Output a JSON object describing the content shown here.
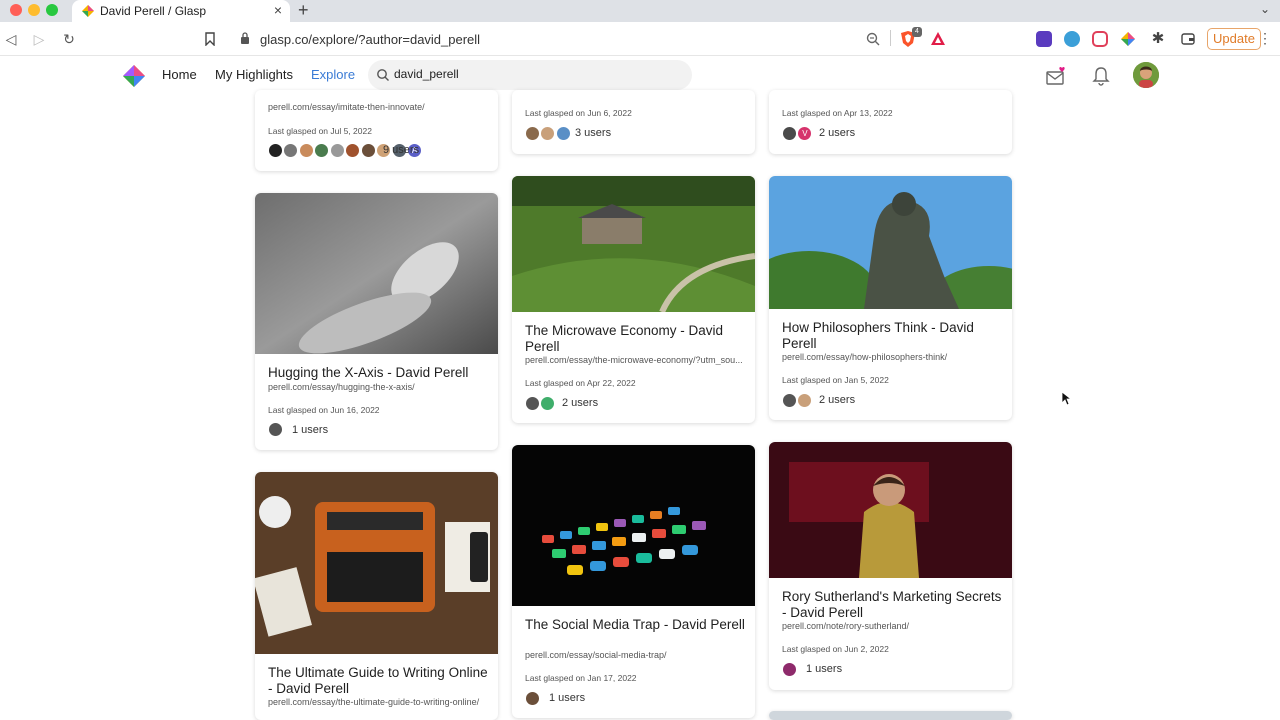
{
  "browser": {
    "tab_title": "David Perell / Glasp",
    "tab_close": "×",
    "new_tab": "+",
    "url": "glasp.co/explore/?author=david_perell",
    "update_label": "Update",
    "brave_badge": "4"
  },
  "app": {
    "nav": {
      "home": "Home",
      "my_highlights": "My Highlights",
      "explore": "Explore"
    },
    "search": {
      "value": "david_perell"
    }
  },
  "cards": [
    {
      "url": "perell.com/essay/imitate-then-innovate/",
      "date": "Last glasped on Jul 5, 2022",
      "users": "9 users"
    },
    {
      "date": "Last glasped on Jun 6, 2022",
      "users": "3 users"
    },
    {
      "date": "Last glasped on Apr 13, 2022",
      "users": "2 users",
      "avatar_letter": "V"
    },
    {
      "title": "Hugging the X-Axis - David Perell",
      "url": "perell.com/essay/hugging-the-x-axis/",
      "date": "Last glasped on Jun 16, 2022",
      "users": "1 users"
    },
    {
      "title": "The Microwave Economy - David Perell",
      "url": "perell.com/essay/the-microwave-economy/?utm_sou...",
      "date": "Last glasped on Apr 22, 2022",
      "users": "2 users"
    },
    {
      "title": "How Philosophers Think - David Perell",
      "url": "perell.com/essay/how-philosophers-think/",
      "date": "Last glasped on Jan 5, 2022",
      "users": "2 users"
    },
    {
      "title": "The Ultimate Guide to Writing Online - David Perell",
      "url": "perell.com/essay/the-ultimate-guide-to-writing-online/"
    },
    {
      "title": "The Social Media Trap - David Perell",
      "url": "perell.com/essay/social-media-trap/",
      "date": "Last glasped on Jan 17, 2022",
      "users": "1 users"
    },
    {
      "title": "Rory Sutherland's Marketing Secrets - David Perell",
      "url": "perell.com/note/rory-sutherland/",
      "date": "Last glasped on Jun 2, 2022",
      "users": "1 users"
    }
  ],
  "first_card_avatar_letter": "A"
}
